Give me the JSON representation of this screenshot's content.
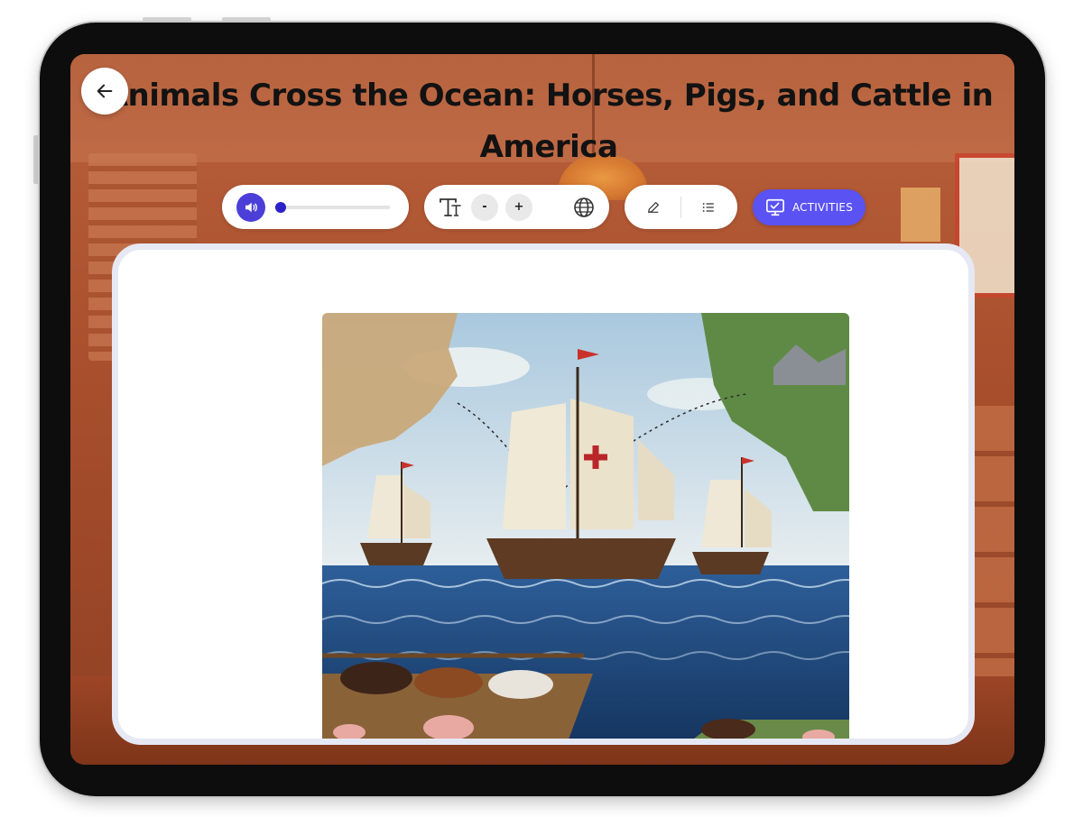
{
  "lesson": {
    "title": "Animals Cross the Ocean: Horses, Pigs, and Cattle in America"
  },
  "toolbar": {
    "audio": {
      "play_icon": "speaker-icon",
      "progress": 0.02
    },
    "font": {
      "decrease_label": "-",
      "increase_label": "+",
      "icon": "text-size-icon",
      "language_icon": "globe-icon"
    },
    "tools": {
      "pencil_icon": "pencil-icon",
      "list_icon": "list-icon"
    },
    "activities_label": "ACTIVITIES"
  },
  "colors": {
    "accent": "#5a52f2",
    "audio_button": "#4b3fd8",
    "card_border": "#e6e8f4",
    "background_tint": "#b0552f"
  }
}
